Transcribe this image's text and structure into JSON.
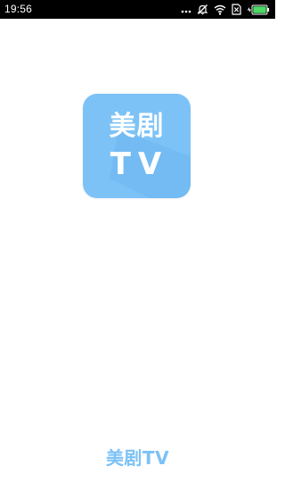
{
  "status_bar": {
    "time": "19:56",
    "icons": [
      "dots-icon",
      "mute-icon",
      "wifi-icon",
      "no-sim-icon",
      "battery-charging-icon"
    ]
  },
  "splash": {
    "app_icon_line1": "美剧",
    "app_icon_line2": "TV",
    "bottom_brand": "美剧TV"
  },
  "colors": {
    "status_bar_bg": "#000000",
    "background": "#ffffff",
    "brand_blue": "#7cc2f7",
    "battery_green": "#4cd964"
  }
}
